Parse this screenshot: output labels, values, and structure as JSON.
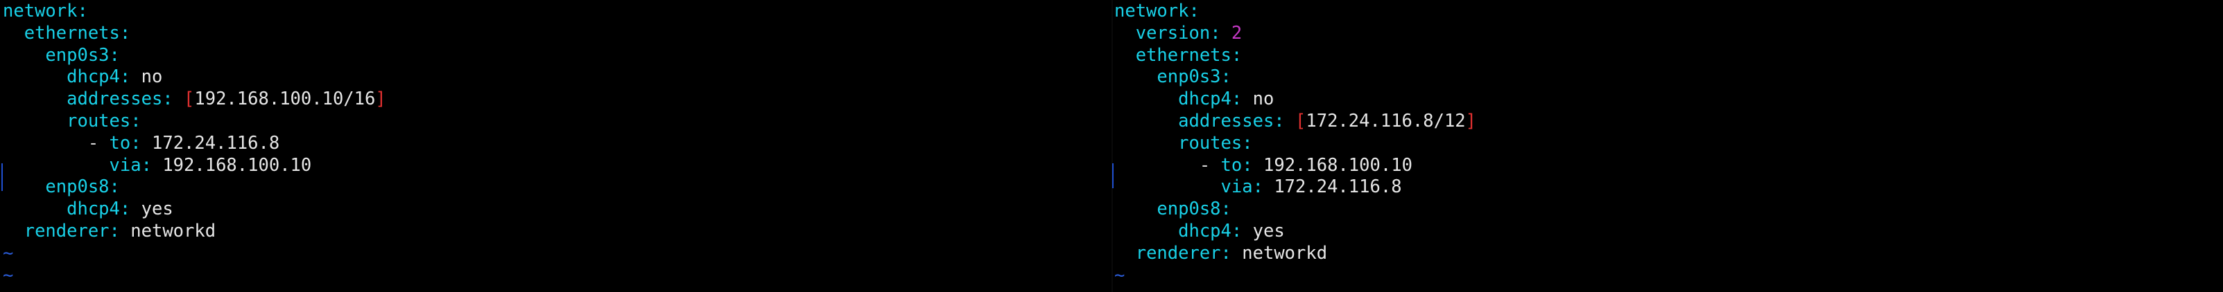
{
  "left_pane": {
    "lines": [
      {
        "indent": "",
        "key": "network",
        "sep": ":"
      },
      {
        "indent": "  ",
        "key": "ethernets",
        "sep": ":"
      },
      {
        "indent": "    ",
        "key": "enp0s3",
        "sep": ":"
      },
      {
        "indent": "      ",
        "key": "dhcp4",
        "sep": ": ",
        "value": "no"
      },
      {
        "indent": "      ",
        "key": "addresses",
        "sep": ": ",
        "bracket_open": "[",
        "value": "192.168.100.10/16",
        "bracket_close": "]"
      },
      {
        "indent": "      ",
        "key": "routes",
        "sep": ":"
      },
      {
        "indent": "        ",
        "dash": "- ",
        "key": "to",
        "sep": ": ",
        "value": "172.24.116.8"
      },
      {
        "indent": "          ",
        "key": "via",
        "sep": ": ",
        "value": "192.168.100.10"
      },
      {
        "indent": "    ",
        "key": "enp0s8",
        "sep": ":"
      },
      {
        "indent": "      ",
        "key": "dhcp4",
        "sep": ": ",
        "value": "yes"
      },
      {
        "indent": "  ",
        "key": "renderer",
        "sep": ": ",
        "value": "networkd"
      }
    ],
    "tildes": [
      "~",
      "~"
    ]
  },
  "right_pane": {
    "lines": [
      {
        "indent": "",
        "key": "network",
        "sep": ":"
      },
      {
        "indent": "  ",
        "key": "version",
        "sep": ": ",
        "number": "2"
      },
      {
        "indent": "  ",
        "key": "ethernets",
        "sep": ":"
      },
      {
        "indent": "    ",
        "key": "enp0s3",
        "sep": ":"
      },
      {
        "indent": "      ",
        "key": "dhcp4",
        "sep": ": ",
        "value": "no"
      },
      {
        "indent": "      ",
        "key": "addresses",
        "sep": ": ",
        "bracket_open": "[",
        "value": "172.24.116.8/12",
        "bracket_close": "]"
      },
      {
        "indent": "      ",
        "key": "routes",
        "sep": ":"
      },
      {
        "indent": "        ",
        "dash": "- ",
        "key": "to",
        "sep": ": ",
        "value": "192.168.100.10"
      },
      {
        "indent": "          ",
        "key": "via",
        "sep": ": ",
        "value": "172.24.116.8"
      },
      {
        "indent": "    ",
        "key": "enp0s8",
        "sep": ":"
      },
      {
        "indent": "      ",
        "key": "dhcp4",
        "sep": ": ",
        "value": "yes"
      },
      {
        "indent": "  ",
        "key": "renderer",
        "sep": ": ",
        "value": "networkd"
      }
    ],
    "tildes": [
      "~"
    ]
  },
  "colors": {
    "background": "#000000",
    "key": "#19d1e8",
    "number": "#c638c6",
    "bracket": "#e03030",
    "tilde": "#2a5cd8",
    "text": "#e6e6e6"
  }
}
